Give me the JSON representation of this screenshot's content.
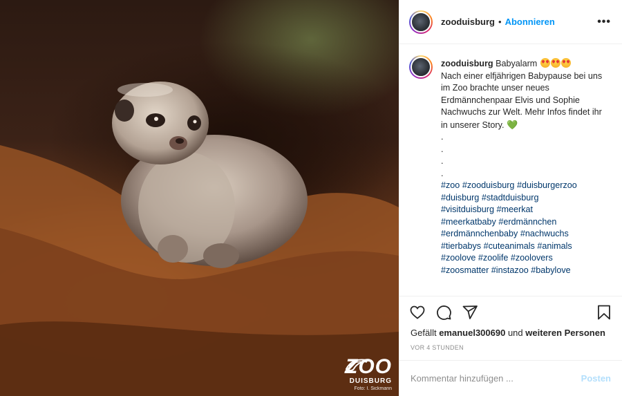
{
  "header": {
    "username": "zooduisburg",
    "separator": "•",
    "follow_label": "Abonnieren",
    "more_label": "•••",
    "avatar_icon": "gorilla-avatar"
  },
  "caption": {
    "username": "zooduisburg",
    "title": "Babyalarm",
    "emojis": [
      "heart-eyes-emoji",
      "heart-eyes-emoji",
      "heart-eyes-emoji"
    ],
    "text": "Nach einer elfjährigen Babypause bei uns im Zoo brachte unser neues Erdmännchenpaar Elvis und Sophie Nachwuchs zur Welt. Mehr Infos findet ihr in unserer Story.",
    "end_emoji": "💚",
    "dots": [
      ".",
      ".",
      ".",
      "."
    ],
    "hashtags": [
      "#zoo",
      "#zooduisburg",
      "#duisburgerzoo",
      "#duisburg",
      "#stadtduisburg",
      "#visitduisburg",
      "#meerkat",
      "#meerkatbaby",
      "#erdmännchen",
      "#erdmännchenbaby",
      "#nachwuchs",
      "#tierbabys",
      "#cuteanimals",
      "#animals",
      "#zoolove",
      "#zoolife",
      "#zoolovers",
      "#zoosmatter",
      "#instazoo",
      "#babylove"
    ]
  },
  "actions": {
    "icons": [
      "heart-icon",
      "comment-icon",
      "share-icon",
      "bookmark-icon"
    ]
  },
  "likes": {
    "prefix": "Gefällt",
    "user": "emanuel300690",
    "connector": "und",
    "suffix": "weiteren Personen"
  },
  "timestamp": "VOR 4 STUNDEN",
  "comment_box": {
    "placeholder": "Kommentar hinzufügen ...",
    "post_label": "Posten"
  },
  "photo": {
    "subject": "meerkat pup on soil",
    "watermark": {
      "logo": "ZOO",
      "city": "DUISBURG",
      "credit": "Foto: I. Sickmann"
    }
  },
  "colors": {
    "link_blue": "#0095f6",
    "hashtag": "#00376b",
    "post_disabled": "#b3dffc",
    "muted": "#8e8e8e"
  }
}
